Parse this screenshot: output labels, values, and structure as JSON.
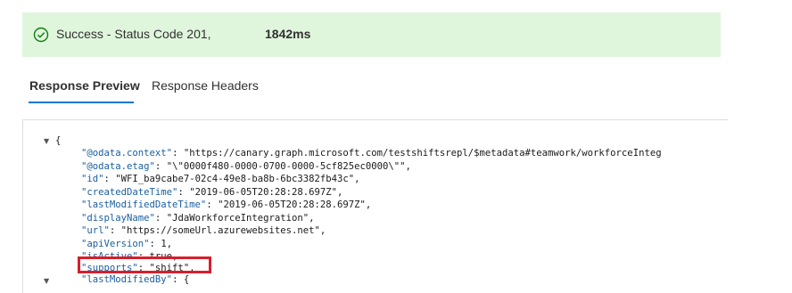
{
  "status": {
    "text": "Success - Status Code 201,",
    "duration": "1842ms",
    "icon": "check-circle-icon",
    "background_color": "#dff6dd",
    "icon_color": "#107c10"
  },
  "tabs": [
    {
      "label": "Response Preview",
      "active": true
    },
    {
      "label": "Response Headers",
      "active": false
    }
  ],
  "accent_color": "#0078d4",
  "highlight_color": "#d81e2c",
  "code": {
    "open_brace": "{",
    "lines": [
      {
        "key": "\"@odata.context\"",
        "value": "\"https://canary.graph.microsoft.com/testshiftsrepl/$metadata#teamwork/workforceInteg"
      },
      {
        "key": "\"@odata.etag\"",
        "value": "\"\\\"0000f480-0000-0700-0000-5cf825ec0000\\\"\","
      },
      {
        "key": "\"id\"",
        "value": "\"WFI_ba9cabe7-02c4-49e8-ba8b-6bc3382fb43c\","
      },
      {
        "key": "\"createdDateTime\"",
        "value": "\"2019-06-05T20:28:28.697Z\","
      },
      {
        "key": "\"lastModifiedDateTime\"",
        "value": "\"2019-06-05T20:28:28.697Z\","
      },
      {
        "key": "\"displayName\"",
        "value": "\"JdaWorkforceIntegration\","
      },
      {
        "key": "\"url\"",
        "value": "\"https://someUrl.azurewebsites.net\","
      },
      {
        "key": "\"apiVersion\"",
        "value": "1,"
      },
      {
        "key": "\"isActive\"",
        "value": "true,"
      },
      {
        "key": "\"supports\"",
        "value": "\"shift\","
      },
      {
        "key": "\"lastModifiedBy\"",
        "value": "{"
      }
    ]
  }
}
